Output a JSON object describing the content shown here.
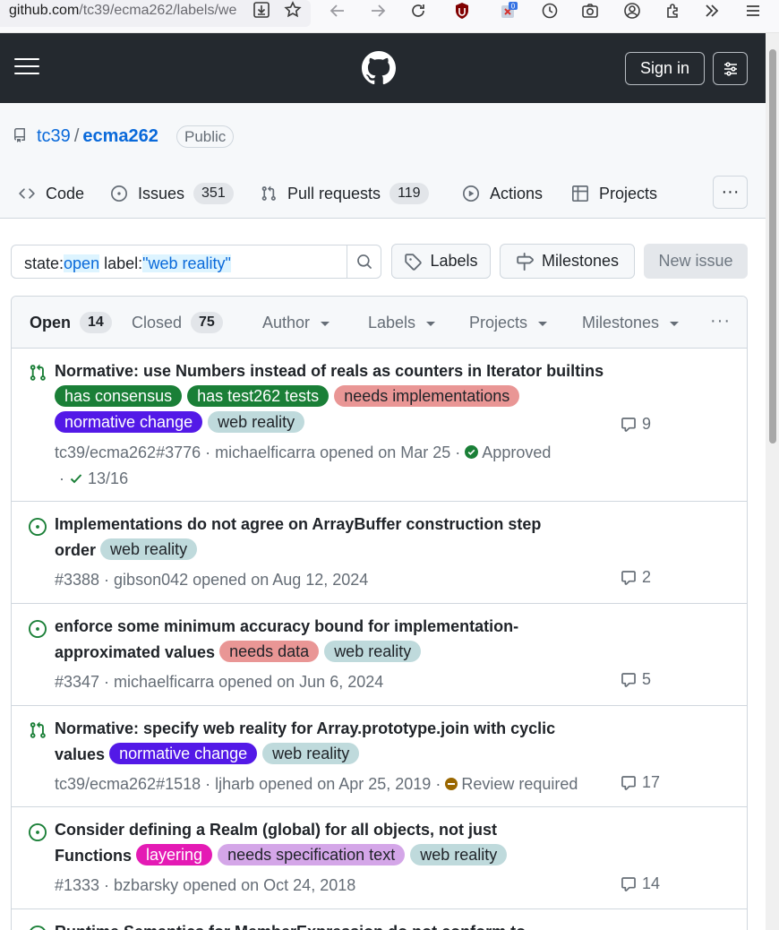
{
  "browser": {
    "url_host": "github.com",
    "url_path": "/tc39/ecma262/labels/we",
    "ext_badge": "0"
  },
  "header": {
    "sign_in": "Sign in"
  },
  "repo": {
    "owner": "tc39",
    "separator": "/",
    "name": "ecma262",
    "visibility": "Public"
  },
  "nav": {
    "code": "Code",
    "issues": "Issues",
    "issues_count": "351",
    "pulls": "Pull requests",
    "pulls_count": "119",
    "actions": "Actions",
    "projects": "Projects",
    "more": "···"
  },
  "search": {
    "k1": "state:",
    "v1": "open",
    "k2": "label:",
    "v2": "\"web reality\""
  },
  "toolbar": {
    "labels": "Labels",
    "milestones": "Milestones",
    "new_issue": "New issue"
  },
  "list_header": {
    "open_label": "Open",
    "open_count": "14",
    "closed_label": "Closed",
    "closed_count": "75",
    "author": "Author",
    "labels": "Labels",
    "projects": "Projects",
    "milestones": "Milestones",
    "more": "···"
  },
  "label_colors": {
    "has consensus": {
      "bg": "#1a7f37",
      "fg": "#ffffff"
    },
    "has test262 tests": {
      "bg": "#1a7f37",
      "fg": "#ffffff"
    },
    "needs implementations": {
      "bg": "#e99695",
      "fg": "#1f2328"
    },
    "normative change": {
      "bg": "#5319e7",
      "fg": "#ffffff"
    },
    "web reality": {
      "bg": "#bfdadc",
      "fg": "#1f2328"
    },
    "needs data": {
      "bg": "#e99695",
      "fg": "#1f2328"
    },
    "layering": {
      "bg": "#e41ab4",
      "fg": "#ffffff"
    },
    "needs specification text": {
      "bg": "#d4a6e8",
      "fg": "#1f2328"
    }
  },
  "issues": [
    {
      "type": "pr",
      "title": "Normative: use Numbers instead of reals as counters in Iterator builtins",
      "labels": [
        "has consensus",
        "has test262 tests",
        "needs implementations",
        "normative change",
        "web reality"
      ],
      "meta": "tc39/ecma262#3776 · michaelficarra opened on Mar 25 ·",
      "review": "Approved",
      "review_color": "#1a7f37",
      "checks_prefix": "·",
      "checks": "13/16",
      "comments": "9"
    },
    {
      "type": "issue",
      "title": "Implementations do not agree on ArrayBuffer construction step order",
      "labels": [
        "web reality"
      ],
      "meta": "#3388 · gibson042 opened on Aug 12, 2024",
      "comments": "2"
    },
    {
      "type": "issue",
      "title": "enforce some minimum accuracy bound for implementation-approximated values",
      "labels": [
        "needs data",
        "web reality"
      ],
      "meta": "#3347 · michaelficarra opened on Jun 6, 2024",
      "comments": "5"
    },
    {
      "type": "pr",
      "title": "Normative: specify web reality for Array.prototype.join with cyclic values",
      "labels": [
        "normative change",
        "web reality"
      ],
      "meta": "tc39/ecma262#1518 · ljharb opened on Apr 25, 2019 ·",
      "review": "Review required",
      "review_color": "#9a6700",
      "comments": "17"
    },
    {
      "type": "issue",
      "title": "Consider defining a Realm (global) for all objects, not just Functions",
      "labels": [
        "layering",
        "needs specification text",
        "web reality"
      ],
      "meta": "#1333 · bzbarsky opened on Oct 24, 2018",
      "comments": "14"
    },
    {
      "type": "issue",
      "title": "Runtime Semantics for MemberExpression do not conform to",
      "labels": [],
      "meta": "",
      "comments": ""
    }
  ]
}
